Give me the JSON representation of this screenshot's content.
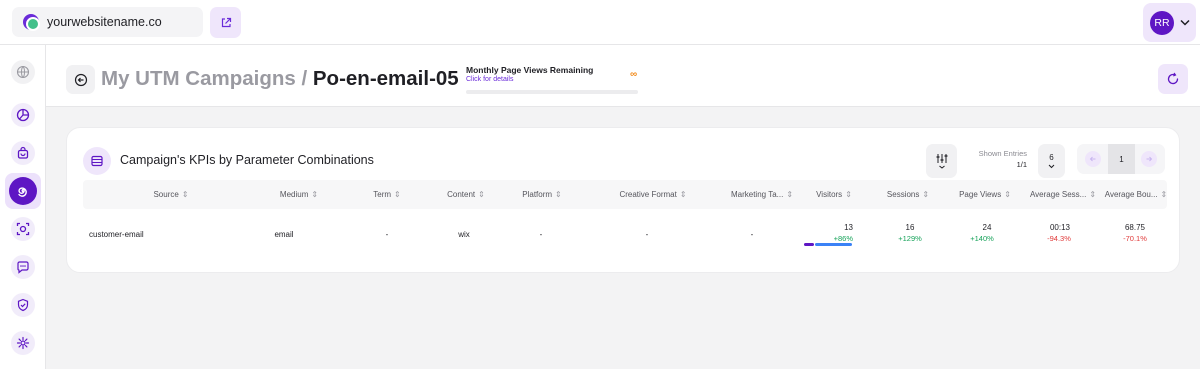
{
  "topbar": {
    "site_name": "yourwebsitename.co",
    "user_initials": "RR"
  },
  "sidebar": {
    "items": [
      {
        "name": "overview",
        "icon": "globe-icon"
      },
      {
        "name": "analytics",
        "icon": "pie-chart-icon"
      },
      {
        "name": "ecommerce",
        "icon": "shopping-bag-icon"
      },
      {
        "name": "campaigns",
        "icon": "spiral-icon",
        "active": true
      },
      {
        "name": "tracking",
        "icon": "target-icon"
      },
      {
        "name": "messages",
        "icon": "chat-icon"
      },
      {
        "name": "security",
        "icon": "shield-check-icon"
      },
      {
        "name": "settings",
        "icon": "gear-icon"
      }
    ]
  },
  "header": {
    "title_prefix": "My UTM Campaigns /",
    "title_current": "Po-en-email-05",
    "views_label": "Monthly Page Views Remaining",
    "views_link": "Click for details",
    "views_value": "∞"
  },
  "card": {
    "title": "Campaign's KPIs by Parameter Combinations",
    "entries_label": "Shown Entries",
    "entries_count": "1/1",
    "entries_per_page": "6",
    "current_page": "1",
    "sort_glyph": "⇕",
    "columns": [
      "Source",
      "Medium",
      "Term",
      "Content",
      "Platform",
      "Creative Format",
      "Marketing Ta...",
      "Visitors",
      "Sessions",
      "Page Views",
      "Average Sess...",
      "Average Bou..."
    ],
    "row": {
      "source": "customer-email",
      "medium": "email",
      "term": "-",
      "content": "wix",
      "platform": "-",
      "creative_format": "-",
      "marketing_tactic": "-",
      "visitors": "13",
      "visitors_delta": "+86%",
      "visitors_split": [
        0.2,
        0.8
      ],
      "sessions": "16",
      "sessions_delta": "+129%",
      "page_views": "24",
      "page_views_delta": "+140%",
      "avg_session": "00:13",
      "avg_session_delta": "-94.3%",
      "avg_bounce": "68.75",
      "avg_bounce_delta": "-70.1%"
    }
  },
  "colors": {
    "brand": "#5e16c4",
    "brand_light": "#efe6fb",
    "positive": "#17a35a",
    "negative": "#e13b3b",
    "infinity": "#f28a1a",
    "visitors_bar_new": "#5e16c4",
    "visitors_bar_returning": "#3b82f6"
  }
}
